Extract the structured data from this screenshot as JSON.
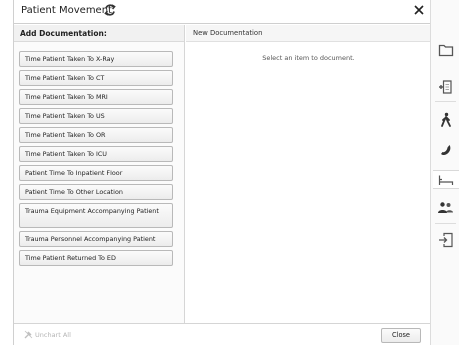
{
  "dialog": {
    "title": "Patient Movement",
    "left_header": "Add Documentation:",
    "right_header": "New Documentation",
    "empty_message": "Select an item to document.",
    "documentation_items": [
      "Time Patient Taken To X-Ray",
      "Time Patient Taken To CT",
      "Time Patient Taken To MRI",
      "Time Patient Taken To US",
      "Time Patient Taken To OR",
      "Time Patient Taken To ICU",
      "Patient Time To Inpatient Floor",
      "Patient Time To Other Location",
      "Trauma Equipment Accompanying Patient",
      "Trauma Personnel Accompanying Patient",
      "Time Patient Returned To ED"
    ],
    "footer": {
      "unchart_label": "Unchart All",
      "close_label": "Close"
    }
  },
  "toolbar": {
    "icons": [
      "folder-icon",
      "add-document-icon",
      "walking-person-icon",
      "phone-icon",
      "bed-icon",
      "people-icon",
      "login-icon"
    ]
  },
  "colors": {
    "accent": "#333333",
    "disabled": "#b5b5b5",
    "panel_bg": "#fbfbfb"
  }
}
